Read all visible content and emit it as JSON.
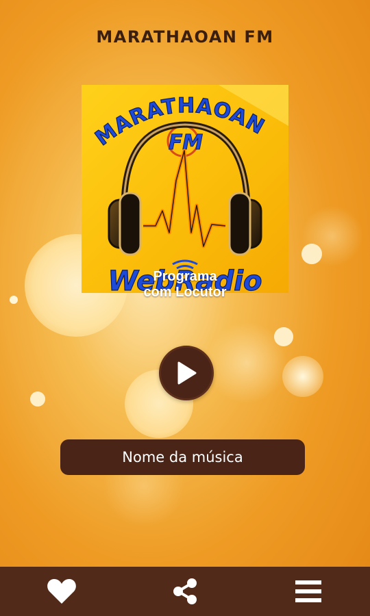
{
  "app": {
    "title": "MARATHAOAN FM"
  },
  "logo": {
    "arc_text": "MARATHAOAN",
    "badge_text": "FM",
    "bottom_text": "WebRadio"
  },
  "program": {
    "line1": "Programa",
    "line2": "com Locutor"
  },
  "player": {
    "icon": "play-icon",
    "now_playing": "Nome da música"
  },
  "nav": {
    "items": [
      {
        "icon": "heart-icon"
      },
      {
        "icon": "share-icon"
      },
      {
        "icon": "menu-icon"
      }
    ]
  },
  "colors": {
    "background_orange": "#ee9b24",
    "dark_brown": "#4a2416",
    "bottom_bar": "#522a1a",
    "title_text": "#3a1f10"
  }
}
